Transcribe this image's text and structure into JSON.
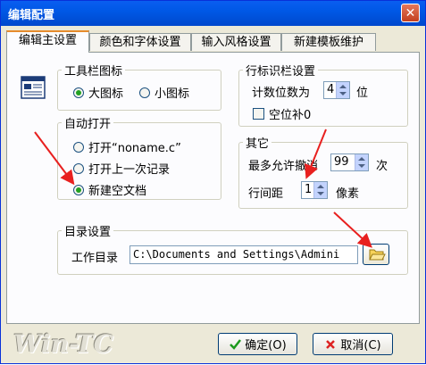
{
  "window": {
    "title": "编辑配置",
    "close_glyph": "✕"
  },
  "tabs": [
    {
      "label": "编辑主设置"
    },
    {
      "label": "颜色和字体设置"
    },
    {
      "label": "输入风格设置"
    },
    {
      "label": "新建模板维护"
    }
  ],
  "toolbar_icon": {
    "label": "工具栏图标",
    "options": [
      {
        "label": "大图标",
        "selected": true
      },
      {
        "label": "小图标",
        "selected": false
      }
    ]
  },
  "line_number": {
    "label": "行标识栏设置",
    "digits_label": "计数位数为",
    "digits_value": "4",
    "digits_unit": "位",
    "pad_zero_label": "空位补0",
    "pad_zero_checked": false
  },
  "auto_open": {
    "label": "自动打开",
    "options": [
      {
        "label": "打开“noname.c”",
        "selected": false
      },
      {
        "label": "打开上一次记录",
        "selected": false
      },
      {
        "label": "新建空文档",
        "selected": true
      }
    ]
  },
  "other": {
    "label": "其它",
    "undo_label": "最多允许撤消",
    "undo_value": "99",
    "undo_unit": "次",
    "spacing_label": "行间距",
    "spacing_value": "1",
    "spacing_unit": "像素"
  },
  "directory": {
    "label": "目录设置",
    "work_dir_label": "工作目录",
    "work_dir_value": "C:\\Documents and Settings\\Admini"
  },
  "buttons": {
    "ok": "确定(O)",
    "cancel": "取消(C)"
  },
  "logo": "Win-TC",
  "colors": {
    "accent": "#0058e6",
    "radio_dot": "#21a121",
    "annotation_arrow": "#e8201f"
  }
}
